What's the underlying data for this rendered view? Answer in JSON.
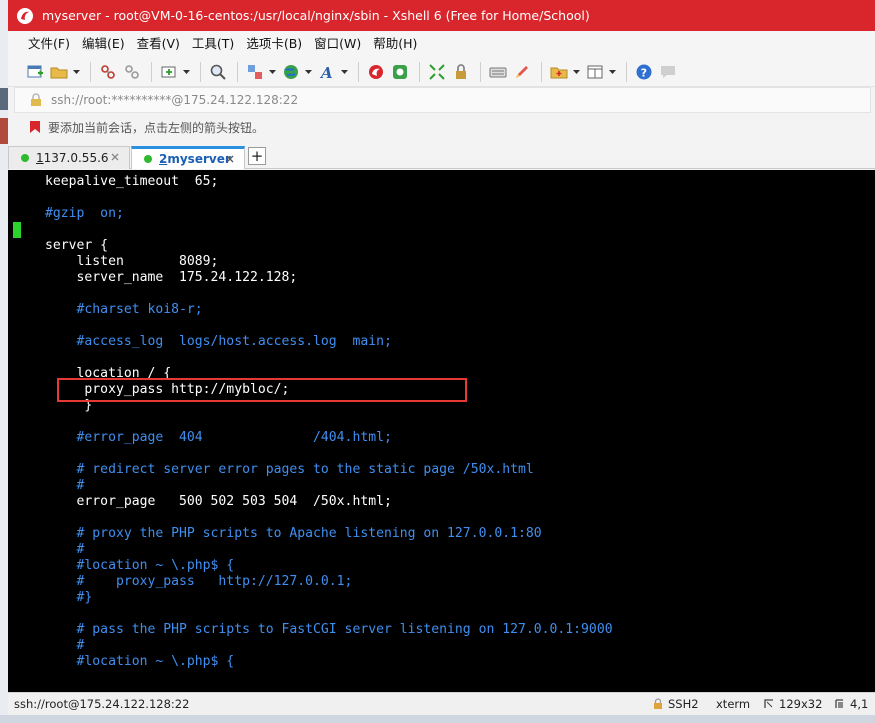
{
  "window": {
    "title": "myserver - root@VM-0-16-centos:/usr/local/nginx/sbin - Xshell 6 (Free for Home/School)"
  },
  "menu": [
    "文件(F)",
    "编辑(E)",
    "查看(V)",
    "工具(T)",
    "选项卡(B)",
    "窗口(W)",
    "帮助(H)"
  ],
  "address": {
    "text": "ssh://root:**********@175.24.122.128:22"
  },
  "hint": {
    "text": "要添加当前会话，点击左侧的箭头按钮。"
  },
  "tabs": [
    {
      "index": "1",
      "label": " 137.0.55.6",
      "status": "connected"
    },
    {
      "index": "2",
      "label": " myserver",
      "status": "connected",
      "active": true
    }
  ],
  "terminal": {
    "lines": [
      {
        "text": "keepalive_timeout  65;",
        "kind": "plain"
      },
      {
        "text": "",
        "kind": "plain"
      },
      {
        "text": "#gzip  on;",
        "kind": "comment"
      },
      {
        "text": "",
        "kind": "plain"
      },
      {
        "text": "server {",
        "kind": "plain"
      },
      {
        "text": "    listen       8089;",
        "kind": "plain"
      },
      {
        "text": "    server_name  175.24.122.128;",
        "kind": "plain"
      },
      {
        "text": "",
        "kind": "plain"
      },
      {
        "text": "    #charset koi8-r;",
        "kind": "comment"
      },
      {
        "text": "",
        "kind": "plain"
      },
      {
        "text": "    #access_log  logs/host.access.log  main;",
        "kind": "comment"
      },
      {
        "text": "",
        "kind": "plain"
      },
      {
        "text": "    location / {",
        "kind": "plain"
      },
      {
        "text": "     proxy_pass http://mybloc/;",
        "kind": "plain"
      },
      {
        "text": "     }",
        "kind": "plain"
      },
      {
        "text": "",
        "kind": "plain"
      },
      {
        "text": "    #error_page  404              /404.html;",
        "kind": "comment"
      },
      {
        "text": "",
        "kind": "plain"
      },
      {
        "text": "    # redirect server error pages to the static page /50x.html",
        "kind": "comment"
      },
      {
        "text": "    #",
        "kind": "comment"
      },
      {
        "text": "    error_page   500 502 503 504  /50x.html;",
        "kind": "plain"
      },
      {
        "text": "",
        "kind": "plain"
      },
      {
        "text": "    # proxy the PHP scripts to Apache listening on 127.0.0.1:80",
        "kind": "comment"
      },
      {
        "text": "    #",
        "kind": "comment"
      },
      {
        "text": "    #location ~ \\.php$ {",
        "kind": "comment"
      },
      {
        "text": "    #    proxy_pass   http://127.0.0.1;",
        "kind": "comment"
      },
      {
        "text": "    #}",
        "kind": "comment"
      },
      {
        "text": "",
        "kind": "plain"
      },
      {
        "text": "    # pass the PHP scripts to FastCGI server listening on 127.0.0.1:9000",
        "kind": "comment"
      },
      {
        "text": "    #",
        "kind": "comment"
      },
      {
        "text": "    #location ~ \\.php$ {",
        "kind": "comment"
      }
    ]
  },
  "status": {
    "connection": "ssh://root@175.24.122.128:22",
    "protocol": "SSH2",
    "term": "xterm",
    "size": "129x32",
    "position": "4,1"
  },
  "colors": {
    "titlebar": "#d8262c",
    "terminal_bg": "#000000",
    "terminal_text": "#ffffff",
    "terminal_comment": "#3f8ff0",
    "cursor": "#2bd42b",
    "highlight_box": "#e53935",
    "active_tab_accent": "#2b91de"
  }
}
